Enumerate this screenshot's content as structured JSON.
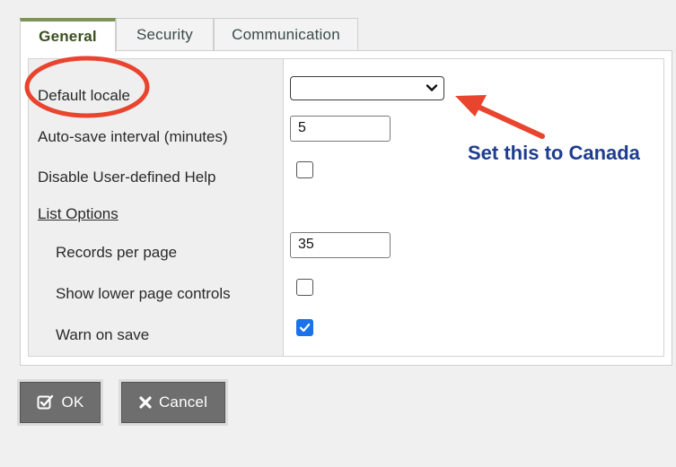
{
  "tabs": [
    {
      "label": "General",
      "active": true
    },
    {
      "label": "Security",
      "active": false
    },
    {
      "label": "Communication",
      "active": false
    }
  ],
  "form": {
    "default_locale": {
      "label": "Default locale",
      "value": ""
    },
    "autosave": {
      "label": "Auto-save interval (minutes)",
      "value": "5"
    },
    "disable_help": {
      "label": "Disable User-defined Help",
      "checked": false
    },
    "list_options": {
      "label": "List Options"
    },
    "records_per_page": {
      "label": "Records per page",
      "value": "35"
    },
    "show_lower_controls": {
      "label": "Show lower page controls",
      "checked": false
    },
    "warn_on_save": {
      "label": "Warn on save",
      "checked": true
    }
  },
  "annotation": {
    "text": "Set this to Canada",
    "color": "#1e3d8f",
    "highlight_color": "#e8442e"
  },
  "buttons": {
    "ok_label": "OK",
    "cancel_label": "Cancel"
  },
  "colors": {
    "accent_tab": "#7d9456",
    "checkbox_checked": "#1a73e8",
    "button_bg": "#6e6e6e"
  }
}
